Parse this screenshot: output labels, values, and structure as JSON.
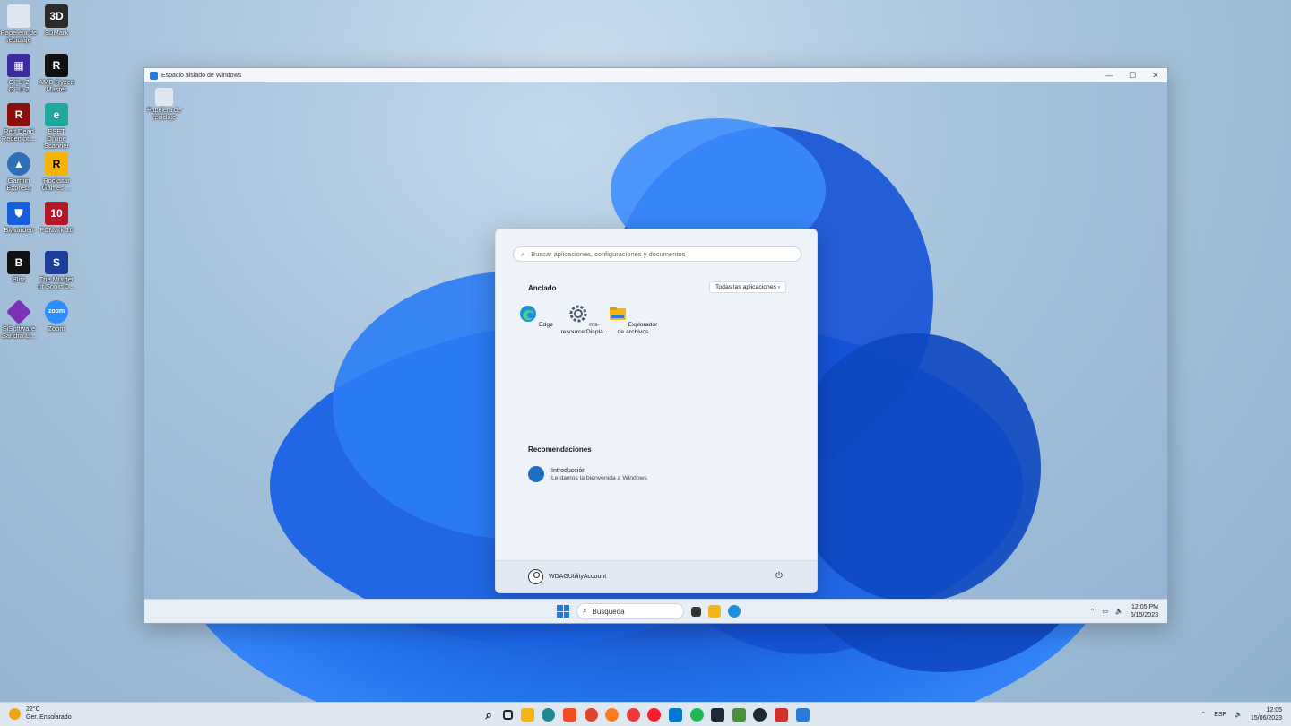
{
  "host": {
    "desktop_icons": [
      {
        "label": "Papelera de reciclaje",
        "icon": "recycle-bin-icon",
        "color": "#dfe8f0"
      },
      {
        "label": "3DMark",
        "icon": "3dmark-icon",
        "color": "#2b2b2b"
      },
      {
        "label": "GPU-Z GPU-Z",
        "icon": "gpuz-icon",
        "color": "#3c2aa0"
      },
      {
        "label": "AMD Ryzen Master",
        "icon": "ryzen-icon",
        "color": "#111111"
      },
      {
        "label": "Red Dead Redempti...",
        "icon": "rdr-icon",
        "color": "#8a1010"
      },
      {
        "label": "ESET Online Scanner",
        "icon": "eset-icon",
        "color": "#1fa7a0"
      },
      {
        "label": "Garmin Express",
        "icon": "garmin-icon",
        "color": "#2f6fb5"
      },
      {
        "label": "Rockstar Games ...",
        "icon": "rockstar-icon",
        "color": "#f6b400"
      },
      {
        "label": "Bitwarden",
        "icon": "bitwarden-icon",
        "color": "#175ddc"
      },
      {
        "label": "PCMark 10",
        "icon": "pcmark-icon",
        "color": "#b0182a"
      },
      {
        "label": "Blitz",
        "icon": "blitz-icon",
        "color": "#111111"
      },
      {
        "label": "The Murder of Sonic C...",
        "icon": "sonic-icon",
        "color": "#1c3f9e"
      },
      {
        "label": "SiSoftware Sandra Li...",
        "icon": "sandra-icon",
        "color": "#7d2fb8"
      },
      {
        "label": "Zoom",
        "icon": "zoom-icon",
        "color": "#2d8cff"
      }
    ],
    "weather": {
      "temp": "22°C",
      "desc": "Ger. Ensolarado"
    },
    "taskbar_apps": [
      {
        "name": "start",
        "icon": "windows-start-icon",
        "color": "#1f7ae0"
      },
      {
        "name": "search",
        "icon": "search-icon",
        "color": "#222222"
      },
      {
        "name": "task-view",
        "icon": "task-view-icon",
        "color": "#222222"
      },
      {
        "name": "file-explorer",
        "icon": "folder-icon",
        "color": "#f2b61c"
      },
      {
        "name": "edge",
        "icon": "edge-icon",
        "color": "#1d8a8f"
      },
      {
        "name": "brave",
        "icon": "brave-icon",
        "color": "#f04e23"
      },
      {
        "name": "chrome",
        "icon": "chrome-icon",
        "color": "#e0442f"
      },
      {
        "name": "firefox",
        "icon": "firefox-icon",
        "color": "#ff7a1a"
      },
      {
        "name": "vivaldi",
        "icon": "vivaldi-icon",
        "color": "#ef3939"
      },
      {
        "name": "opera",
        "icon": "opera-icon",
        "color": "#ff1b2d"
      },
      {
        "name": "vscode",
        "icon": "vscode-icon",
        "color": "#007acc"
      },
      {
        "name": "spotify",
        "icon": "spotify-icon",
        "color": "#1db954"
      },
      {
        "name": "app-dark",
        "icon": "app-icon",
        "color": "#1e2a3a"
      },
      {
        "name": "app-green",
        "icon": "app-icon",
        "color": "#4a8f3c"
      },
      {
        "name": "steam",
        "icon": "steam-icon",
        "color": "#1b2838"
      },
      {
        "name": "snipping",
        "icon": "snipping-tool-icon",
        "color": "#d0312d"
      },
      {
        "name": "sandbox",
        "icon": "sandbox-icon",
        "color": "#2b7bd6"
      }
    ],
    "tray": {
      "lang": "ESP",
      "time": "12:05",
      "date": "15/06/2023"
    }
  },
  "sandbox": {
    "title": "Espacio aislado de Windows",
    "desktop_icon": "Papelera de reciclaje",
    "taskbar": {
      "search_placeholder": "Búsqueda",
      "time": "12:05 PM",
      "date": "6/15/2023"
    },
    "start": {
      "search_placeholder": "Buscar aplicaciones, configuraciones y documentos",
      "pinned_title": "Anclado",
      "all_apps": "Todas las aplicaciones",
      "pinned": [
        {
          "label": "Edge",
          "icon": "edge-icon"
        },
        {
          "label": "ms-resource:Displa...",
          "icon": "gear-icon"
        },
        {
          "label": "Explorador de archivos",
          "icon": "folder-icon"
        }
      ],
      "recommended_title": "Recomendaciones",
      "recommended": {
        "title": "Introducción",
        "subtitle": "Le damos la bienvenida a Windows"
      },
      "user": "WDAGUtilityAccount"
    }
  }
}
